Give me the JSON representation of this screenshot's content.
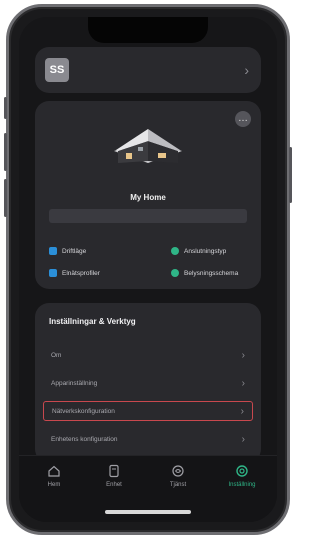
{
  "user": {
    "initials": "SS"
  },
  "home": {
    "name": "My Home",
    "options": [
      {
        "label": "Driftläge",
        "icon": "mode-icon",
        "color": "#2b8fd8"
      },
      {
        "label": "Anslutningstyp",
        "icon": "connection-icon",
        "color": "#2fb587"
      },
      {
        "label": "Elnätsprofiler",
        "icon": "grid-profile-icon",
        "color": "#2b8fd8"
      },
      {
        "label": "Belysningsschema",
        "icon": "lighting-icon",
        "color": "#2fb587"
      }
    ]
  },
  "settings": {
    "title": "Inställningar & Verktyg",
    "rows": [
      {
        "label": "Om"
      },
      {
        "label": "Apparinställning"
      },
      {
        "label": "Nätverkskonfiguration"
      },
      {
        "label": "Enhetens konfiguration"
      }
    ]
  },
  "tabbar": {
    "tabs": [
      {
        "label": "Hem",
        "icon": "home-icon"
      },
      {
        "label": "Enhet",
        "icon": "device-icon"
      },
      {
        "label": "Tjänst",
        "icon": "service-icon"
      },
      {
        "label": "Inställning",
        "icon": "settings-icon"
      }
    ],
    "active_color": "#2fb587"
  }
}
